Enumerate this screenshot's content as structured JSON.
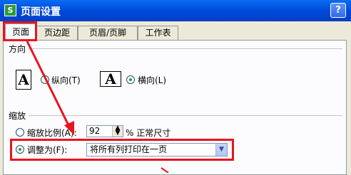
{
  "window": {
    "app_icon_glyph": "S",
    "title": "页面设置",
    "help_glyph": "?"
  },
  "tabs": [
    {
      "label": "页面",
      "active": true
    },
    {
      "label": "页边距",
      "active": false
    },
    {
      "label": "页眉/页脚",
      "active": false
    },
    {
      "label": "工作表",
      "active": false
    }
  ],
  "orientation": {
    "section_label": "方向",
    "icon_letter": "A",
    "portrait_label": "纵向(T)",
    "landscape_label": "横向(L)",
    "selected": "landscape"
  },
  "scaling": {
    "section_label": "缩放",
    "scale_label": "缩放比例(A):",
    "scale_value": "92",
    "scale_suffix": "% 正常尺寸",
    "fit_label": "调整为(F):",
    "fit_value": "将所有列打印在一页",
    "selected": "fit"
  },
  "annotation": {
    "color": "#e8141e"
  }
}
